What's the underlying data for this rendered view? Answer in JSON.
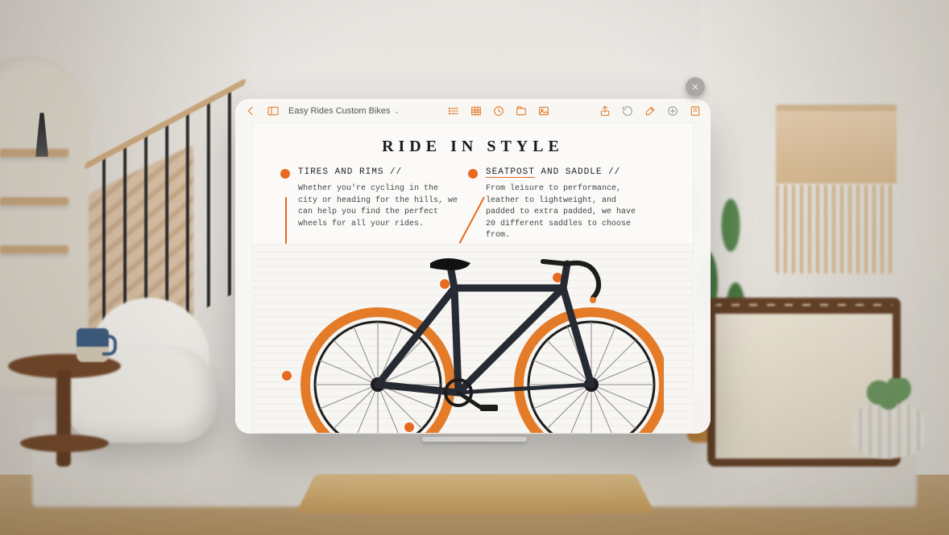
{
  "accent": "#e86a1f",
  "toolbar": {
    "document_title": "Easy Rides Custom Bikes",
    "icons_left": [
      "back",
      "sidebar"
    ],
    "icons_mid": [
      "list",
      "table",
      "clock",
      "media-folder",
      "image"
    ],
    "icons_right": [
      "share",
      "history",
      "brush",
      "add",
      "format"
    ]
  },
  "document": {
    "heading": "RIDE IN STYLE",
    "callouts": [
      {
        "label_pre": "TIRES AND RIMS",
        "label_sep": " // ",
        "body": "Whether you're cycling in the city or heading for the hills, we can help you find the perfect wheels for all your rides."
      },
      {
        "label_keyword": "SEATPOST",
        "label_rest": " AND SADDLE // ",
        "body": "From leisure to performance, leather to lightweight, and padded to extra padded, we have 20 different saddles to choose from."
      }
    ]
  },
  "overlay": {
    "close_label": "Close"
  }
}
